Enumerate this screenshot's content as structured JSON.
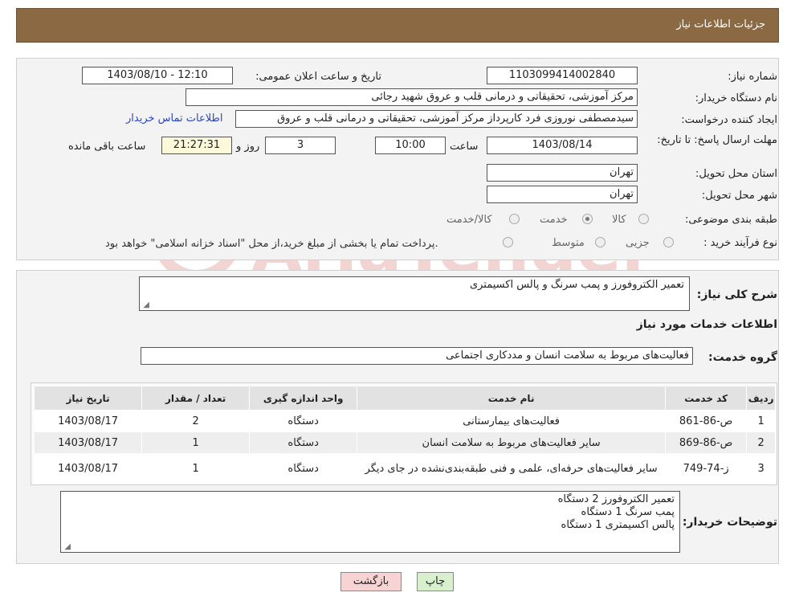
{
  "header": {
    "title": "جزئیات اطلاعات نیاز"
  },
  "watermark": {
    "text": "AriaTender.neT"
  },
  "form": {
    "need_number": {
      "label": "شماره نیاز:",
      "value": "1103099414002840"
    },
    "announce_datetime": {
      "label": "تاریخ و ساعت اعلان عمومی:",
      "value": "1403/08/10 - 12:10"
    },
    "buyer_org": {
      "label": "نام دستگاه خریدار:",
      "value": "مرکز آموزشی، تحقیقاتی و درمانی قلب و عروق شهید رجائی"
    },
    "requester": {
      "label": "ایجاد کننده درخواست:",
      "value": "سیدمصطفی نوروزی فرد کارپرداز مرکز آموزشی، تحقیقاتی و درمانی قلب و عروق"
    },
    "contact_link": "اطلاعات تماس خریدار",
    "deadline": {
      "label": "مهلت ارسال پاسخ: تا تاریخ:",
      "date": "1403/08/14",
      "time_label": "ساعت",
      "time": "10:00",
      "days": "3",
      "days_label": "روز و",
      "remaining": "21:27:31",
      "remaining_label": "ساعت باقی مانده"
    },
    "province": {
      "label": "استان محل تحویل:",
      "value": "تهران"
    },
    "city": {
      "label": "شهر محل تحویل:",
      "value": "تهران"
    },
    "category": {
      "label": "طبقه بندی موضوعی:",
      "options": [
        "کالا",
        "خدمت",
        "کالا/خدمت"
      ],
      "selected": "خدمت"
    },
    "purchase_type": {
      "label": "نوع فرآیند خرید :",
      "options": [
        "جزیی",
        "متوسط"
      ],
      "note": "پرداخت تمام یا بخشی از مبلغ خرید،از محل \"اسناد خزانه اسلامی\" خواهد بود."
    }
  },
  "summary": {
    "label": "شرح کلی نیاز:",
    "value": "تعمیر الکتروفورز و پمب سرنگ و پالس اکسیمتری",
    "services_title": "اطلاعات خدمات مورد نیاز",
    "group_label": "گروه خدمت:",
    "group_value": "فعالیت‌های مربوط به سلامت انسان و مددکاری اجتماعی"
  },
  "table": {
    "headers": [
      "ردیف",
      "کد خدمت",
      "نام خدمت",
      "واحد اندازه گیری",
      "تعداد / مقدار",
      "تاریخ نیاز"
    ],
    "rows": [
      [
        "1",
        "ص-86-861",
        "فعالیت‌های بیمارستانی",
        "دستگاه",
        "2",
        "1403/08/17"
      ],
      [
        "2",
        "ص-86-869",
        "سایر فعالیت‌های مربوط به سلامت انسان",
        "دستگاه",
        "1",
        "1403/08/17"
      ],
      [
        "3",
        "ز-74-749",
        "سایر فعالیت‌های حرفه‌ای، علمی و فنی طبقه‌بندی‌نشده در جای دیگر",
        "دستگاه",
        "1",
        "1403/08/17"
      ]
    ]
  },
  "buyer_notes": {
    "label": "توضیحات خریدار:",
    "lines": [
      "تعمیر الکتروفورز  2 دستگاه",
      "پمب سرنگ  1 دستگاه",
      " پالس اکسیمتری  1 دستگاه"
    ]
  },
  "buttons": {
    "print": "چاپ",
    "back": "بازگشت"
  }
}
